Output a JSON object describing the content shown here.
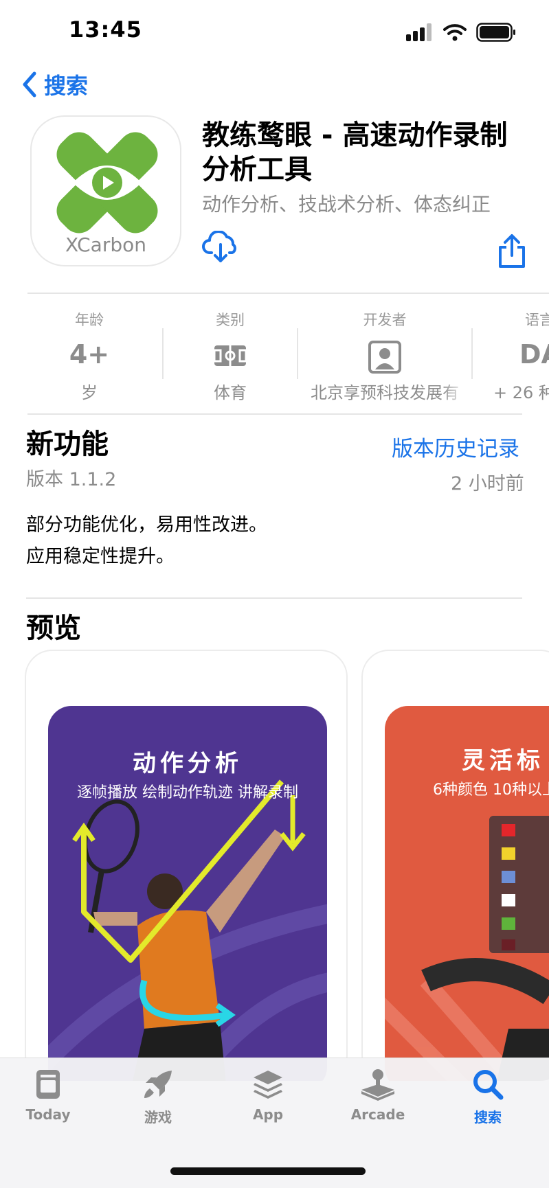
{
  "status": {
    "time": "13:45"
  },
  "nav": {
    "back_label": "搜索"
  },
  "app": {
    "icon_brand": "XCarbon",
    "title": "教练鹜眼 - 高速动作录制分析工具",
    "subtitle": "动作分析、技战术分析、体态纠正"
  },
  "info": {
    "age": {
      "label": "年龄",
      "value": "4+",
      "sub": "岁"
    },
    "category": {
      "label": "类别",
      "icon": "stadium-icon",
      "sub": "体育"
    },
    "developer": {
      "label": "开发者",
      "icon": "person-icon",
      "sub": "北京享预科技发展有"
    },
    "language": {
      "label": "语言",
      "value": "DA",
      "sub": "+ 26 种"
    }
  },
  "whats_new": {
    "title": "新功能",
    "history_link": "版本历史记录",
    "version": "版本 1.1.2",
    "time_ago": "2 小时前",
    "notes": [
      "部分功能优化，易用性改进。",
      "应用稳定性提升。"
    ]
  },
  "preview": {
    "title": "预览",
    "cards": [
      {
        "title": "动作分析",
        "subtitle": "逐帧播放 绘制动作轨迹 讲解录制",
        "color": "#4f3591"
      },
      {
        "title": "灵活标",
        "subtitle": "6种颜色 10种以上",
        "color": "#e05a40"
      }
    ]
  },
  "tabs": [
    {
      "label": "Today",
      "icon": "today-icon"
    },
    {
      "label": "游戏",
      "icon": "rocket-icon"
    },
    {
      "label": "App",
      "icon": "layers-icon"
    },
    {
      "label": "Arcade",
      "icon": "joystick-icon"
    },
    {
      "label": "搜索",
      "icon": "search-icon"
    }
  ],
  "colors": {
    "accent": "#1a73e8",
    "icon_green": "#6db33f"
  }
}
